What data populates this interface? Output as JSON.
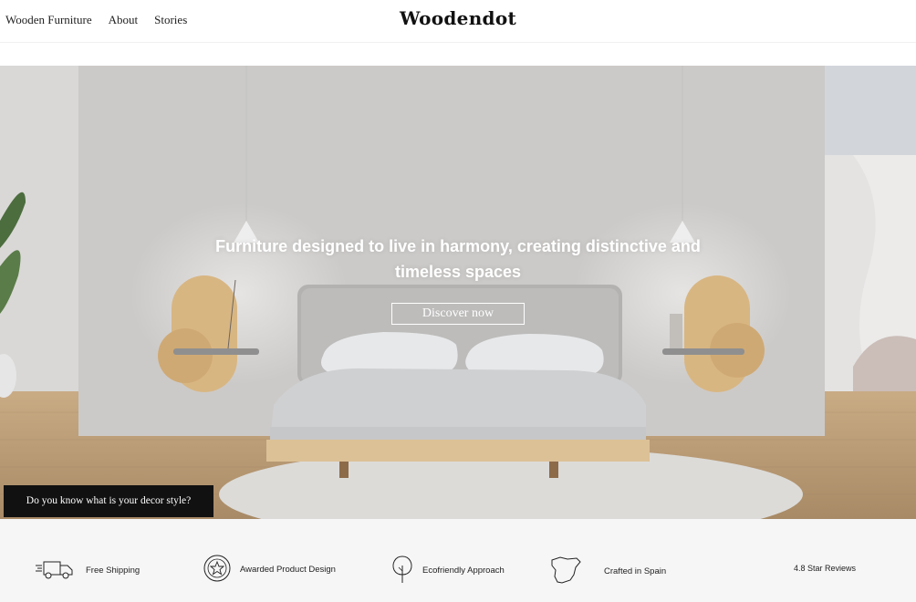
{
  "header": {
    "nav": [
      "Wooden Furniture",
      "About",
      "Stories"
    ],
    "logo": "Woodendot"
  },
  "hero": {
    "headline": "Furniture designed to live in harmony, creating distinctive and timeless spaces",
    "cta_label": "Discover now",
    "decor_button": "Do you know what is your decor style?"
  },
  "features": [
    {
      "label": "Free Shipping",
      "icon": "truck-icon"
    },
    {
      "label": "Awarded Product Design",
      "icon": "award-star-icon"
    },
    {
      "label": "Ecofriendly Approach",
      "icon": "tree-icon"
    },
    {
      "label": "Crafted in Spain",
      "icon": "spain-map-icon"
    },
    {
      "label": "4.8 Star Reviews",
      "icon": ""
    }
  ],
  "colors": {
    "wall": "#cfcecc",
    "wood": "#d9b884",
    "floor": "#b89a74",
    "dark_button": "#111111"
  }
}
